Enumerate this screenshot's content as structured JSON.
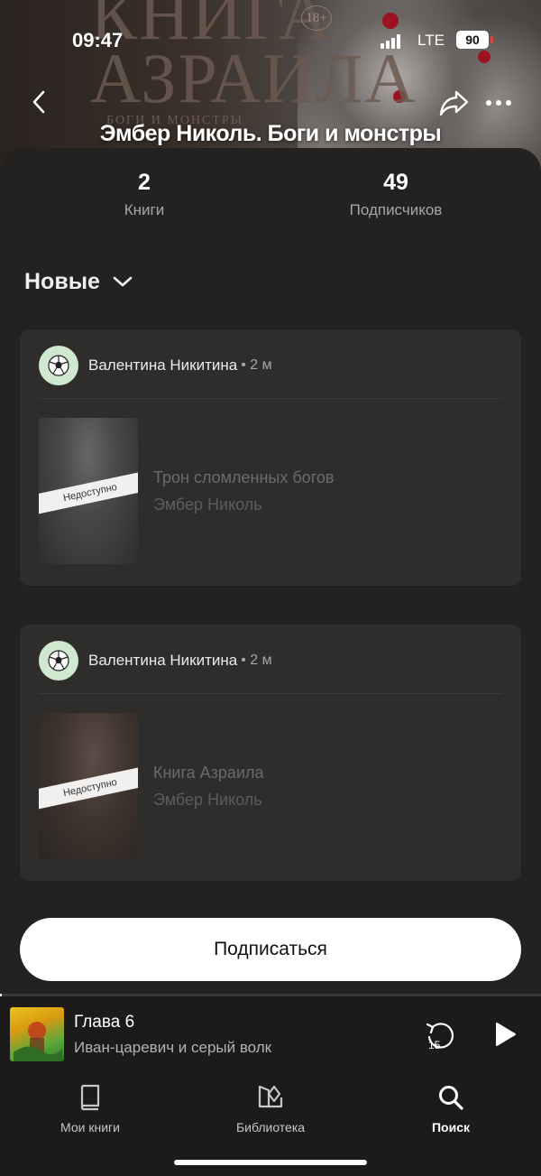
{
  "status_bar": {
    "time": "09:47",
    "network": "LTE",
    "battery": "90"
  },
  "cover": {
    "title_text": "КНИГА АЗРАИЛА",
    "subtitle_text": "БОГИ И МОНСТРЫ",
    "age_rating": "18+"
  },
  "header": {
    "title": "Эмбер Николь. Боги и монстры"
  },
  "stats": [
    {
      "value": "2",
      "label": "Книги"
    },
    {
      "value": "49",
      "label": "Подписчиков"
    }
  ],
  "sort": {
    "label": "Новые"
  },
  "posts": [
    {
      "user": "Валентина Никитина",
      "meta": "• 2 м",
      "avatar_icon": "soccer-ball-icon",
      "book_title": "Трон сломленных богов",
      "book_author": "Эмбер Николь",
      "badge": "Недоступно"
    },
    {
      "user": "Валентина Никитина",
      "meta": "• 2 м",
      "avatar_icon": "soccer-ball-icon",
      "book_title": "Книга Азраила",
      "book_author": "Эмбер Николь",
      "badge": "Недоступно"
    }
  ],
  "subscribe_button": {
    "label": "Подписаться"
  },
  "player": {
    "title": "Глава 6",
    "subtitle": "Иван-царевич и серый волк",
    "rewind_seconds": "15",
    "progress": 0.004
  },
  "tabs": [
    {
      "label": "Мои книги",
      "icon": "book-icon",
      "active": false
    },
    {
      "label": "Библиотека",
      "icon": "library-icon",
      "active": false
    },
    {
      "label": "Поиск",
      "icon": "search-icon",
      "active": true
    }
  ],
  "colors": {
    "background": "#1c1b1a",
    "sheet": "#232221",
    "card": "#2e2d2b",
    "accent": "#ffffff"
  }
}
